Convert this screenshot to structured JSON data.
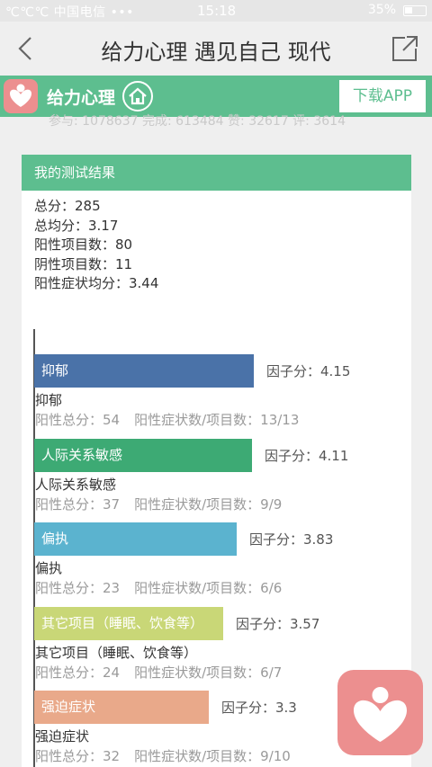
{
  "status_bar": {
    "left": "℃℃℃ 中国电信 •••",
    "carrier": "中国电信",
    "time": "15:18",
    "battery": "35%"
  },
  "nav": {
    "title": "给力心理 遇见自己 现代",
    "back_icon": "chevron-left-icon",
    "share_icon": "share-icon"
  },
  "banner": {
    "app_name": "给力心理",
    "download_label": "下载APP",
    "color": "#5dbe8f"
  },
  "stats_line": "参与: 1078637  完成: 613484  赞: 32617  评: 3614",
  "card": {
    "header": "我的测试结果",
    "summary": [
      "总分：285",
      "总均分：3.17",
      "阳性项目数：80",
      "阴性项目数：11",
      "阳性症状均分：3.44"
    ]
  },
  "chart_data": {
    "type": "bar",
    "orientation": "horizontal",
    "score_prefix": "因子分：",
    "categories": [
      "抑郁",
      "人际关系敏感",
      "偏执",
      "其它项目（睡眠、饮食等）",
      "强迫症状"
    ],
    "values": [
      4.15,
      4.11,
      3.83,
      3.57,
      3.3
    ],
    "colors": [
      "#4a72a8",
      "#3daa74",
      "#5bb3cf",
      "#c9d777",
      "#e9a98a"
    ],
    "positive_total": [
      "阳性总分：54",
      "阳性总分：37",
      "阳性总分：23",
      "阳性总分：24",
      "阳性总分：32"
    ],
    "positive_ratio": [
      "阳性症状数/项目数：13/13",
      "阳性症状数/项目数：9/9",
      "阳性症状数/项目数：6/6",
      "阳性症状数/项目数：6/7",
      "阳性症状数/项目数：9/10"
    ]
  }
}
